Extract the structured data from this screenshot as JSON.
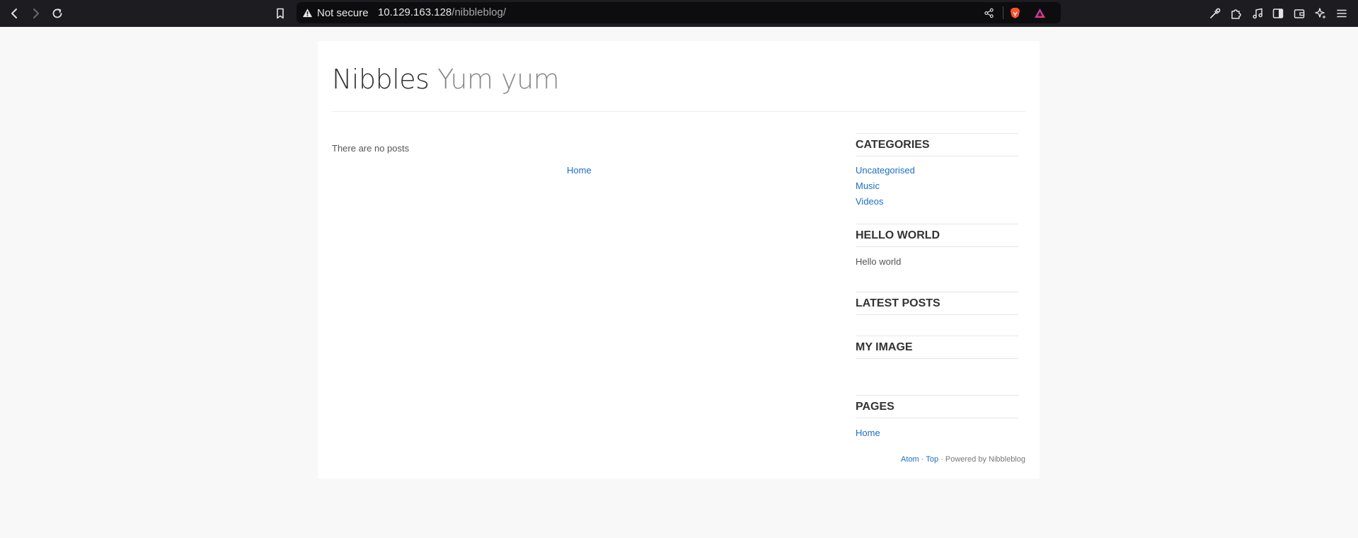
{
  "browser": {
    "security_label": "Not secure",
    "url_host": "10.129.163.128",
    "url_path": "/nibbleblog/"
  },
  "site": {
    "title": "Nibbles",
    "slogan": "Yum yum"
  },
  "main": {
    "empty_message": "There are no posts",
    "pager_home": "Home"
  },
  "sidebar": {
    "categories": {
      "title": "CATEGORIES",
      "items": [
        "Uncategorised",
        "Music",
        "Videos"
      ]
    },
    "hello_world": {
      "title": "HELLO WORLD",
      "text": "Hello world"
    },
    "latest_posts": {
      "title": "LATEST POSTS"
    },
    "my_image": {
      "title": "MY IMAGE"
    },
    "pages": {
      "title": "PAGES",
      "items": [
        "Home"
      ]
    }
  },
  "footer": {
    "atom": "Atom",
    "sep1": "·",
    "top": "Top",
    "powered": "· Powered by Nibbleblog"
  }
}
